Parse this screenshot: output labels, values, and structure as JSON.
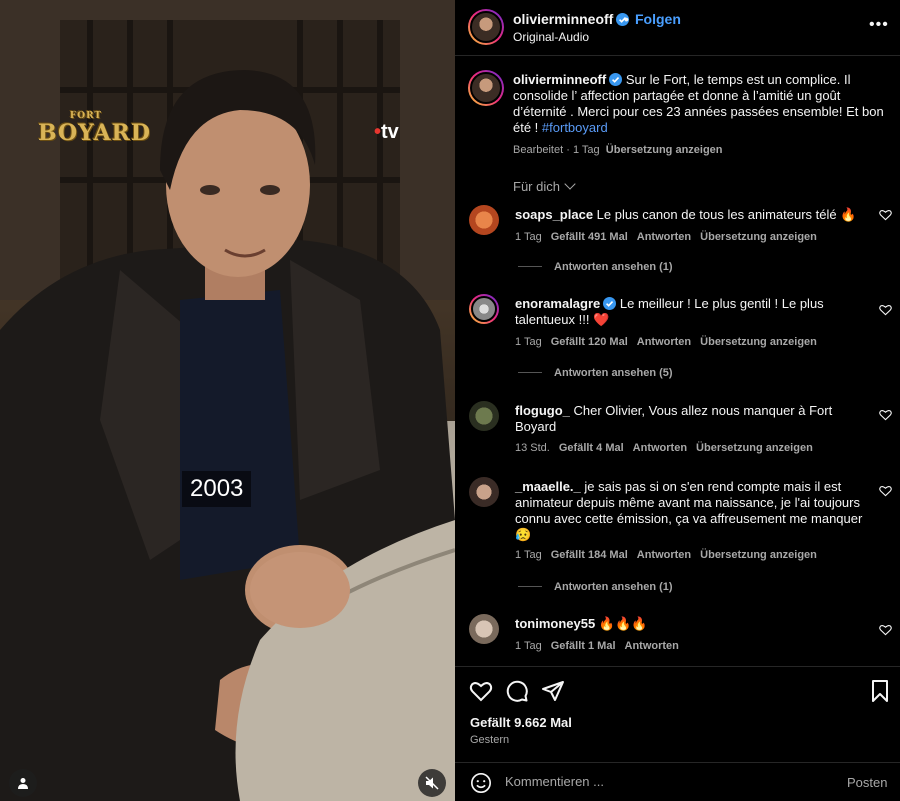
{
  "media": {
    "overlay_year": "2003",
    "logo_text_top": "FORT",
    "logo_text_main": "BOYARD",
    "tv_logo_text": "tv"
  },
  "header": {
    "username": "olivierminneoff",
    "follow_label": "Folgen",
    "audio_label": "Original-Audio",
    "separator": "•"
  },
  "caption": {
    "username": "olivierminneoff",
    "text": "Sur le Fort, le temps est un complice. Il consolide l’ affection partagée et donne à l’amitié un goût d’éternité . Merci pour ces 23 années passées ensemble! Et bon été ! ",
    "hashtag": "#fortboyard",
    "edited": "Bearbeitet",
    "time": "1 Tag",
    "translate": "Übersetzung anzeigen"
  },
  "sort_label": "Für dich",
  "comments": [
    {
      "username": "soaps_place",
      "text": "Le plus canon de tous les animateurs télé 🔥",
      "time": "1 Tag",
      "likes": "Gefällt 491 Mal",
      "reply": "Antworten",
      "translate": "Übersetzung anzeigen",
      "view_replies": "Antworten ansehen (1)",
      "verified": false
    },
    {
      "username": "enoramalagre",
      "text": "Le meilleur ! Le plus gentil ! Le plus talentueux !!! ❤️",
      "time": "1 Tag",
      "likes": "Gefällt 120 Mal",
      "reply": "Antworten",
      "translate": "Übersetzung anzeigen",
      "view_replies": "Antworten ansehen (5)",
      "verified": true
    },
    {
      "username": "flogugo_",
      "text": "Cher Olivier, Vous allez nous manquer à Fort Boyard",
      "time": "13 Std.",
      "likes": "Gefällt 4 Mal",
      "reply": "Antworten",
      "translate": "Übersetzung anzeigen",
      "view_replies": "",
      "verified": false
    },
    {
      "username": "_maaelle._",
      "text": "je sais pas si on s'en rend compte mais il est animateur depuis même avant ma naissance, je l'ai toujours connu avec cette émission, ça va affreusement me manquer 😥",
      "time": "1 Tag",
      "likes": "Gefällt 184 Mal",
      "reply": "Antworten",
      "translate": "Übersetzung anzeigen",
      "view_replies": "Antworten ansehen (1)",
      "verified": false
    },
    {
      "username": "tonimoney55",
      "text": "🔥🔥🔥",
      "time": "1 Tag",
      "likes": "Gefällt 1 Mal",
      "reply": "Antworten",
      "translate": "",
      "view_replies": "",
      "verified": false
    }
  ],
  "footer": {
    "likes": "Gefällt 9.662 Mal",
    "date": "Gestern",
    "comment_placeholder": "Kommentieren ...",
    "post_label": "Posten"
  },
  "colors": {
    "background": "#000000",
    "link_blue": "#4a9fff",
    "hashtag": "#5a9bf6",
    "muted": "#a8a8a8"
  }
}
